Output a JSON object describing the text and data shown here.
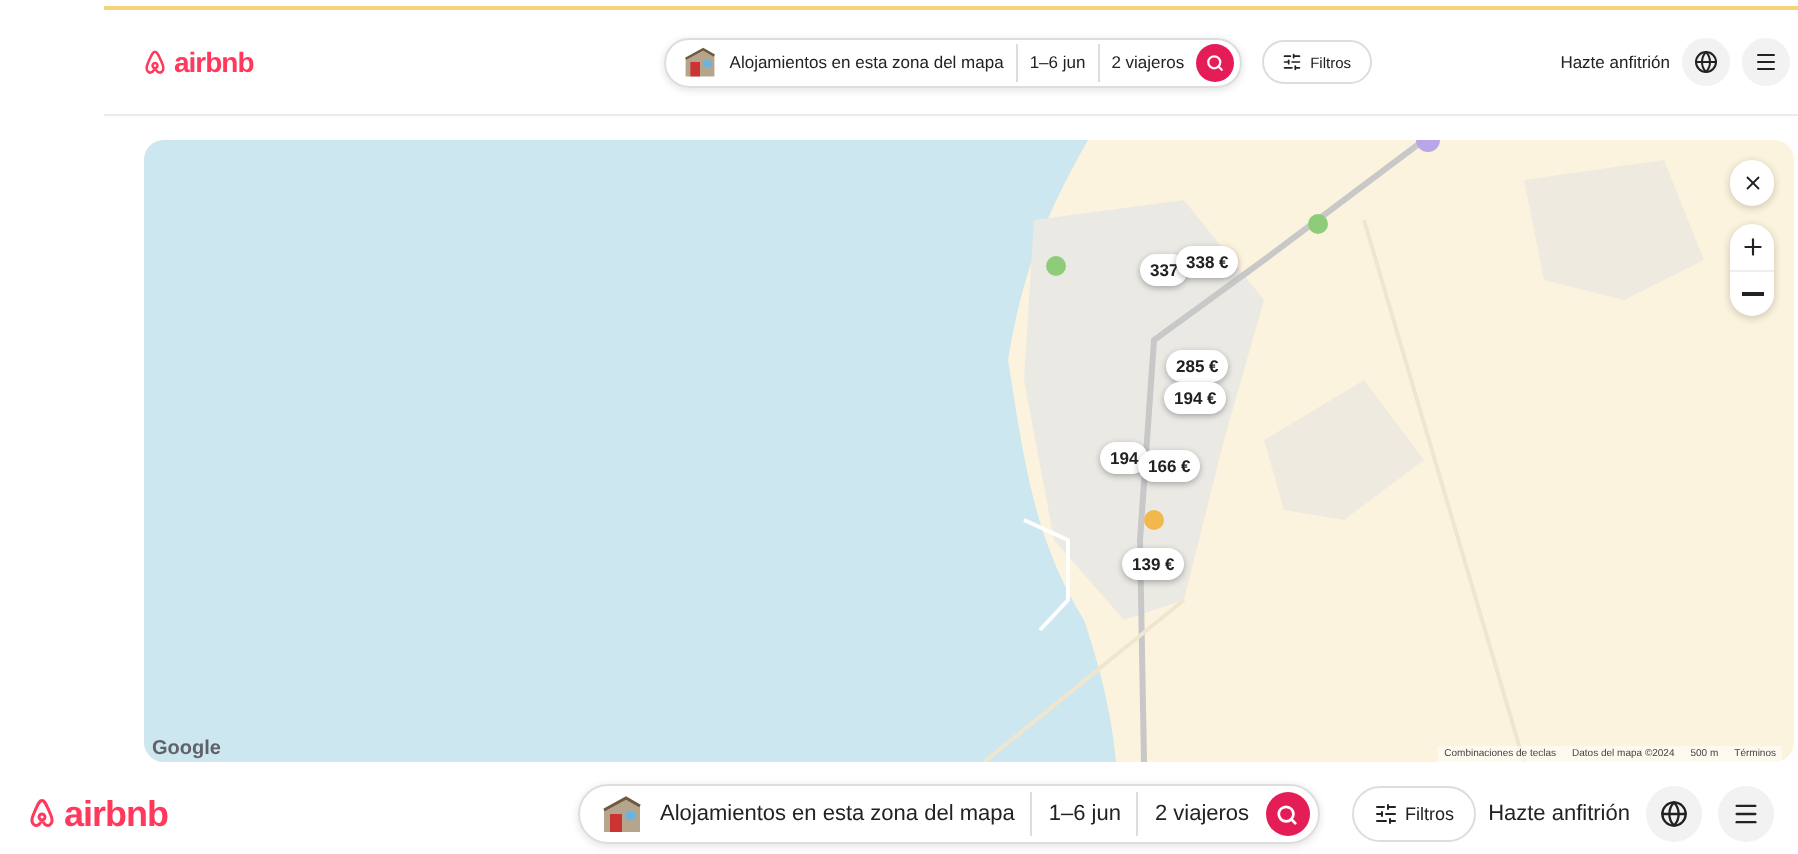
{
  "headers": [
    {
      "logo": "airbnb",
      "search": {
        "location": "Alojamientos en esta zona del mapa",
        "dates": "1–6 jun",
        "guests": "2 viajeros"
      },
      "filters": "Filtros",
      "host": "Hazte anfitrión"
    },
    {
      "logo": "airbnb",
      "search": {
        "location": "Alojamientos en esta zona del mapa",
        "dates": "1–6 jun",
        "guests": "2 viajeros"
      },
      "filters": "Filtros",
      "host": "Hazte anfitrión"
    }
  ],
  "map": {
    "pins": [
      {
        "label": "337"
      },
      {
        "label": "338 €"
      },
      {
        "label": "285 €"
      },
      {
        "label": "194 €"
      },
      {
        "label": "194"
      },
      {
        "label": "166 €"
      },
      {
        "label": "139 €"
      }
    ],
    "attribution": {
      "brand": "Google",
      "shortcuts": "Combinaciones de teclas",
      "data": "Datos del mapa ©2024",
      "scale": "500 m",
      "terms": "Términos"
    }
  }
}
